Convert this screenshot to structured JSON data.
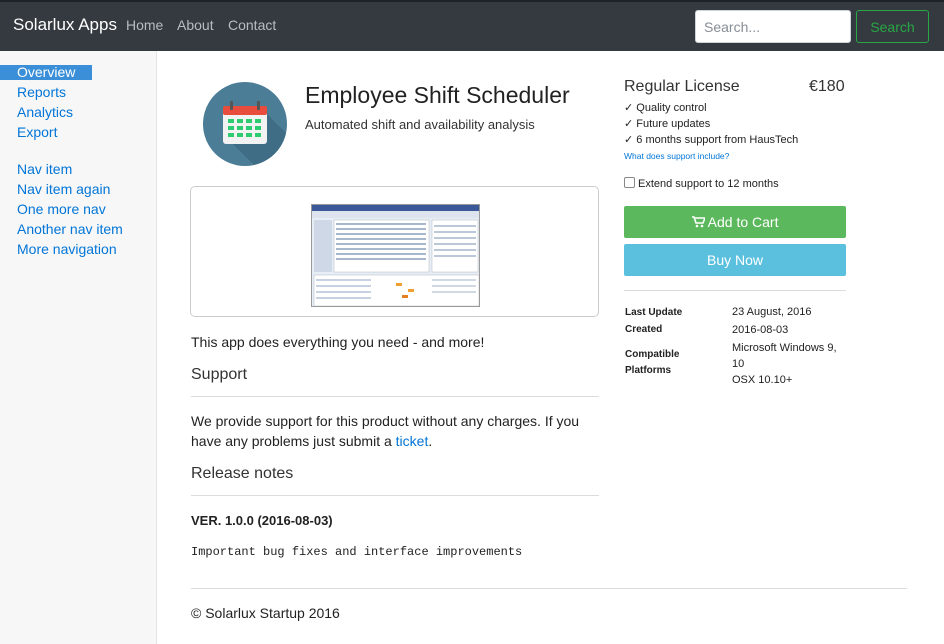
{
  "navbar": {
    "brand": "Solarlux Apps",
    "links": [
      "Home",
      "About",
      "Contact"
    ],
    "search_placeholder": "Search...",
    "search_button": "Search"
  },
  "sidebar": {
    "group1": [
      "Overview",
      "Reports",
      "Analytics",
      "Export"
    ],
    "group2": [
      "Nav item",
      "Nav item again",
      "One more nav",
      "Another nav item",
      "More navigation"
    ]
  },
  "product": {
    "title": "Employee Shift Scheduler",
    "subtitle": "Automated shift and availability analysis",
    "icon": "calendar-icon",
    "description": "This app does everything you need - and more!"
  },
  "support": {
    "heading": "Support",
    "text_before": "We provide support for this product without any charges. If you",
    "text_line2": "have any problems just submit a",
    "link": "ticket",
    "text_after": "."
  },
  "release": {
    "heading": "Release notes",
    "version": "VER. 1.0.0 (2016-08-03)",
    "notes": "Important bug fixes and interface improvements"
  },
  "license": {
    "title": "Regular License",
    "price": "€180",
    "features": [
      "✓ Quality control",
      "✓ Future updates",
      "✓ 6 months support from HausTech"
    ],
    "support_link": "What does support include?",
    "extend_label": "Extend support to 12 months",
    "extend_checked": false,
    "add_to_cart": "Add to Cart",
    "buy_now": "Buy Now"
  },
  "meta": {
    "last_update_label": "Last Update",
    "last_update": "23 August, 2016",
    "created_label": "Created",
    "created": "2016-08-03",
    "compatible_label_1": "Compatible",
    "compatible_label_2": "Platforms",
    "platforms_1": "Microsoft Windows 9,",
    "platforms_2": "10",
    "platforms_3": "OSX 10.10+"
  },
  "footer": "© Solarlux Startup 2016",
  "colors": {
    "navbar": "#343a40",
    "link": "#0275d8",
    "success": "#5cb85c",
    "info": "#5bc0de",
    "active_nav": "#3a8fd8"
  }
}
